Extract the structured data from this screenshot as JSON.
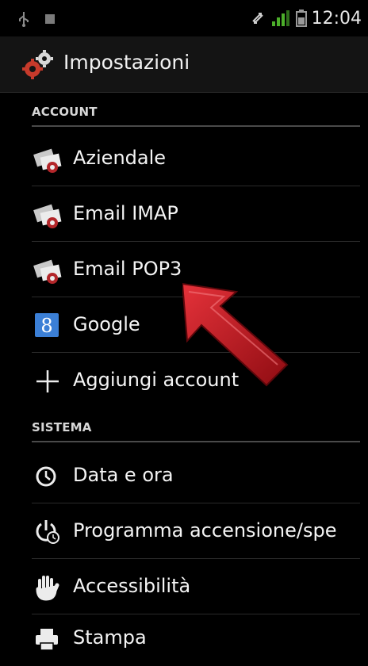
{
  "status_bar": {
    "time": "12:04",
    "icons": [
      "usb-icon",
      "sd-card-icon",
      "sync-icon",
      "signal-icon",
      "battery-icon"
    ]
  },
  "action_bar": {
    "title": "Impostazioni",
    "icon": "settings-gears-icon"
  },
  "sections": [
    {
      "header": "ACCOUNT",
      "items": [
        {
          "label": "Aziendale",
          "icon": "exchange-mail-icon"
        },
        {
          "label": "Email IMAP",
          "icon": "email-icon"
        },
        {
          "label": "Email POP3",
          "icon": "email-icon"
        },
        {
          "label": "Google",
          "icon": "google-icon"
        },
        {
          "label": "Aggiungi account",
          "icon": "plus-icon"
        }
      ]
    },
    {
      "header": "SISTEMA",
      "items": [
        {
          "label": "Data e ora",
          "icon": "clock-icon"
        },
        {
          "label": "Programma accensione/spe",
          "icon": "power-schedule-icon"
        },
        {
          "label": "Accessibilità",
          "icon": "hand-icon"
        },
        {
          "label": "Stampa",
          "icon": "printer-icon"
        }
      ]
    }
  ],
  "colors": {
    "background": "#000000",
    "arrow": "#c8141b",
    "google_blue": "#3b7fd6"
  }
}
